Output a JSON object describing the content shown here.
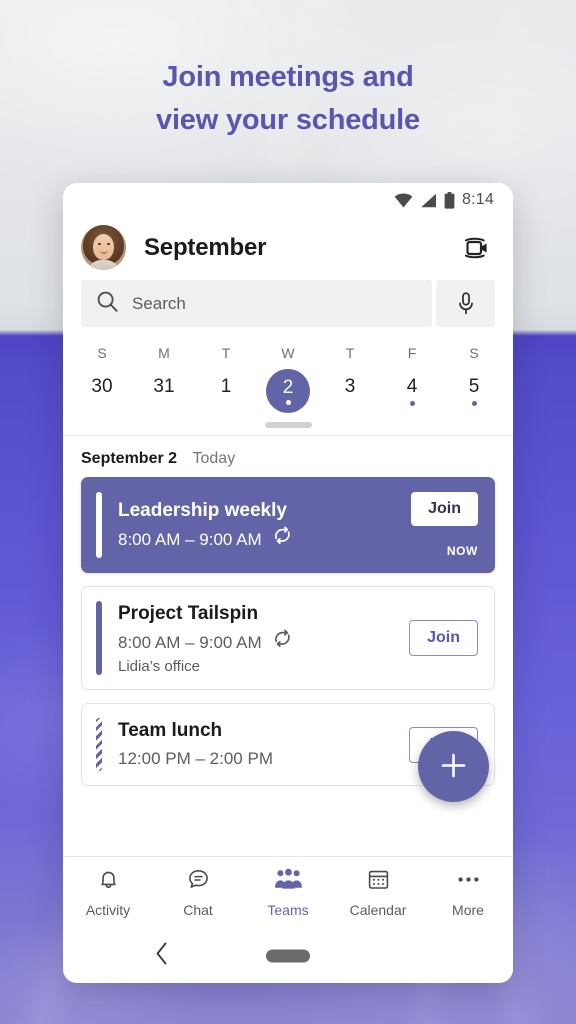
{
  "promo": {
    "headline_line1": "Join meetings and",
    "headline_line2": "view your schedule",
    "headline_color": "#5a56b0"
  },
  "status_bar": {
    "time": "8:14",
    "icons": [
      "wifi-icon",
      "cellular-signal-icon",
      "battery-icon"
    ]
  },
  "app_header": {
    "avatar_name": "user-avatar",
    "title": "September",
    "video_call_icon": "video-camera-icon"
  },
  "search": {
    "placeholder": "Search",
    "search_icon": "search-icon",
    "mic_icon": "microphone-icon"
  },
  "calendar": {
    "day_labels": [
      "S",
      "M",
      "T",
      "W",
      "T",
      "F",
      "S"
    ],
    "days": [
      {
        "num": "30",
        "selected": false,
        "has_event": false
      },
      {
        "num": "31",
        "selected": false,
        "has_event": false
      },
      {
        "num": "1",
        "selected": false,
        "has_event": false
      },
      {
        "num": "2",
        "selected": true,
        "has_event": true
      },
      {
        "num": "3",
        "selected": false,
        "has_event": false
      },
      {
        "num": "4",
        "selected": false,
        "has_event": true
      },
      {
        "num": "5",
        "selected": false,
        "has_event": true
      }
    ],
    "selected_color": "#6264a7"
  },
  "agenda": {
    "date_label": "September 2",
    "today_label": "Today",
    "events": [
      {
        "title": "Leadership weekly",
        "time": "8:00 AM – 9:00 AM",
        "recurring": true,
        "location": "",
        "join_label": "Join",
        "status_label": "NOW",
        "current": true,
        "bar_style": "white"
      },
      {
        "title": "Project Tailspin",
        "time": "8:00 AM – 9:00 AM",
        "recurring": true,
        "location": "Lidia’s office",
        "join_label": "Join",
        "status_label": "",
        "current": false,
        "bar_style": "solid"
      },
      {
        "title": "Team lunch",
        "time": "12:00 PM – 2:00 PM",
        "recurring": false,
        "location": "",
        "join_label": "Join",
        "status_label": "",
        "current": false,
        "bar_style": "striped"
      }
    ]
  },
  "fab": {
    "icon": "plus-icon",
    "color": "#6264a7"
  },
  "bottom_nav": {
    "active_color": "#6264a7",
    "items": [
      {
        "label": "Activity",
        "icon": "bell-icon",
        "active": false
      },
      {
        "label": "Chat",
        "icon": "chat-bubble-icon",
        "active": false
      },
      {
        "label": "Teams",
        "icon": "people-icon",
        "active": true
      },
      {
        "label": "Calendar",
        "icon": "calendar-icon",
        "active": false
      },
      {
        "label": "More",
        "icon": "ellipsis-icon",
        "active": false
      }
    ]
  },
  "android_nav": {
    "back_icon": "back-chevron-icon",
    "home_pill": "home-pill-indicator"
  }
}
